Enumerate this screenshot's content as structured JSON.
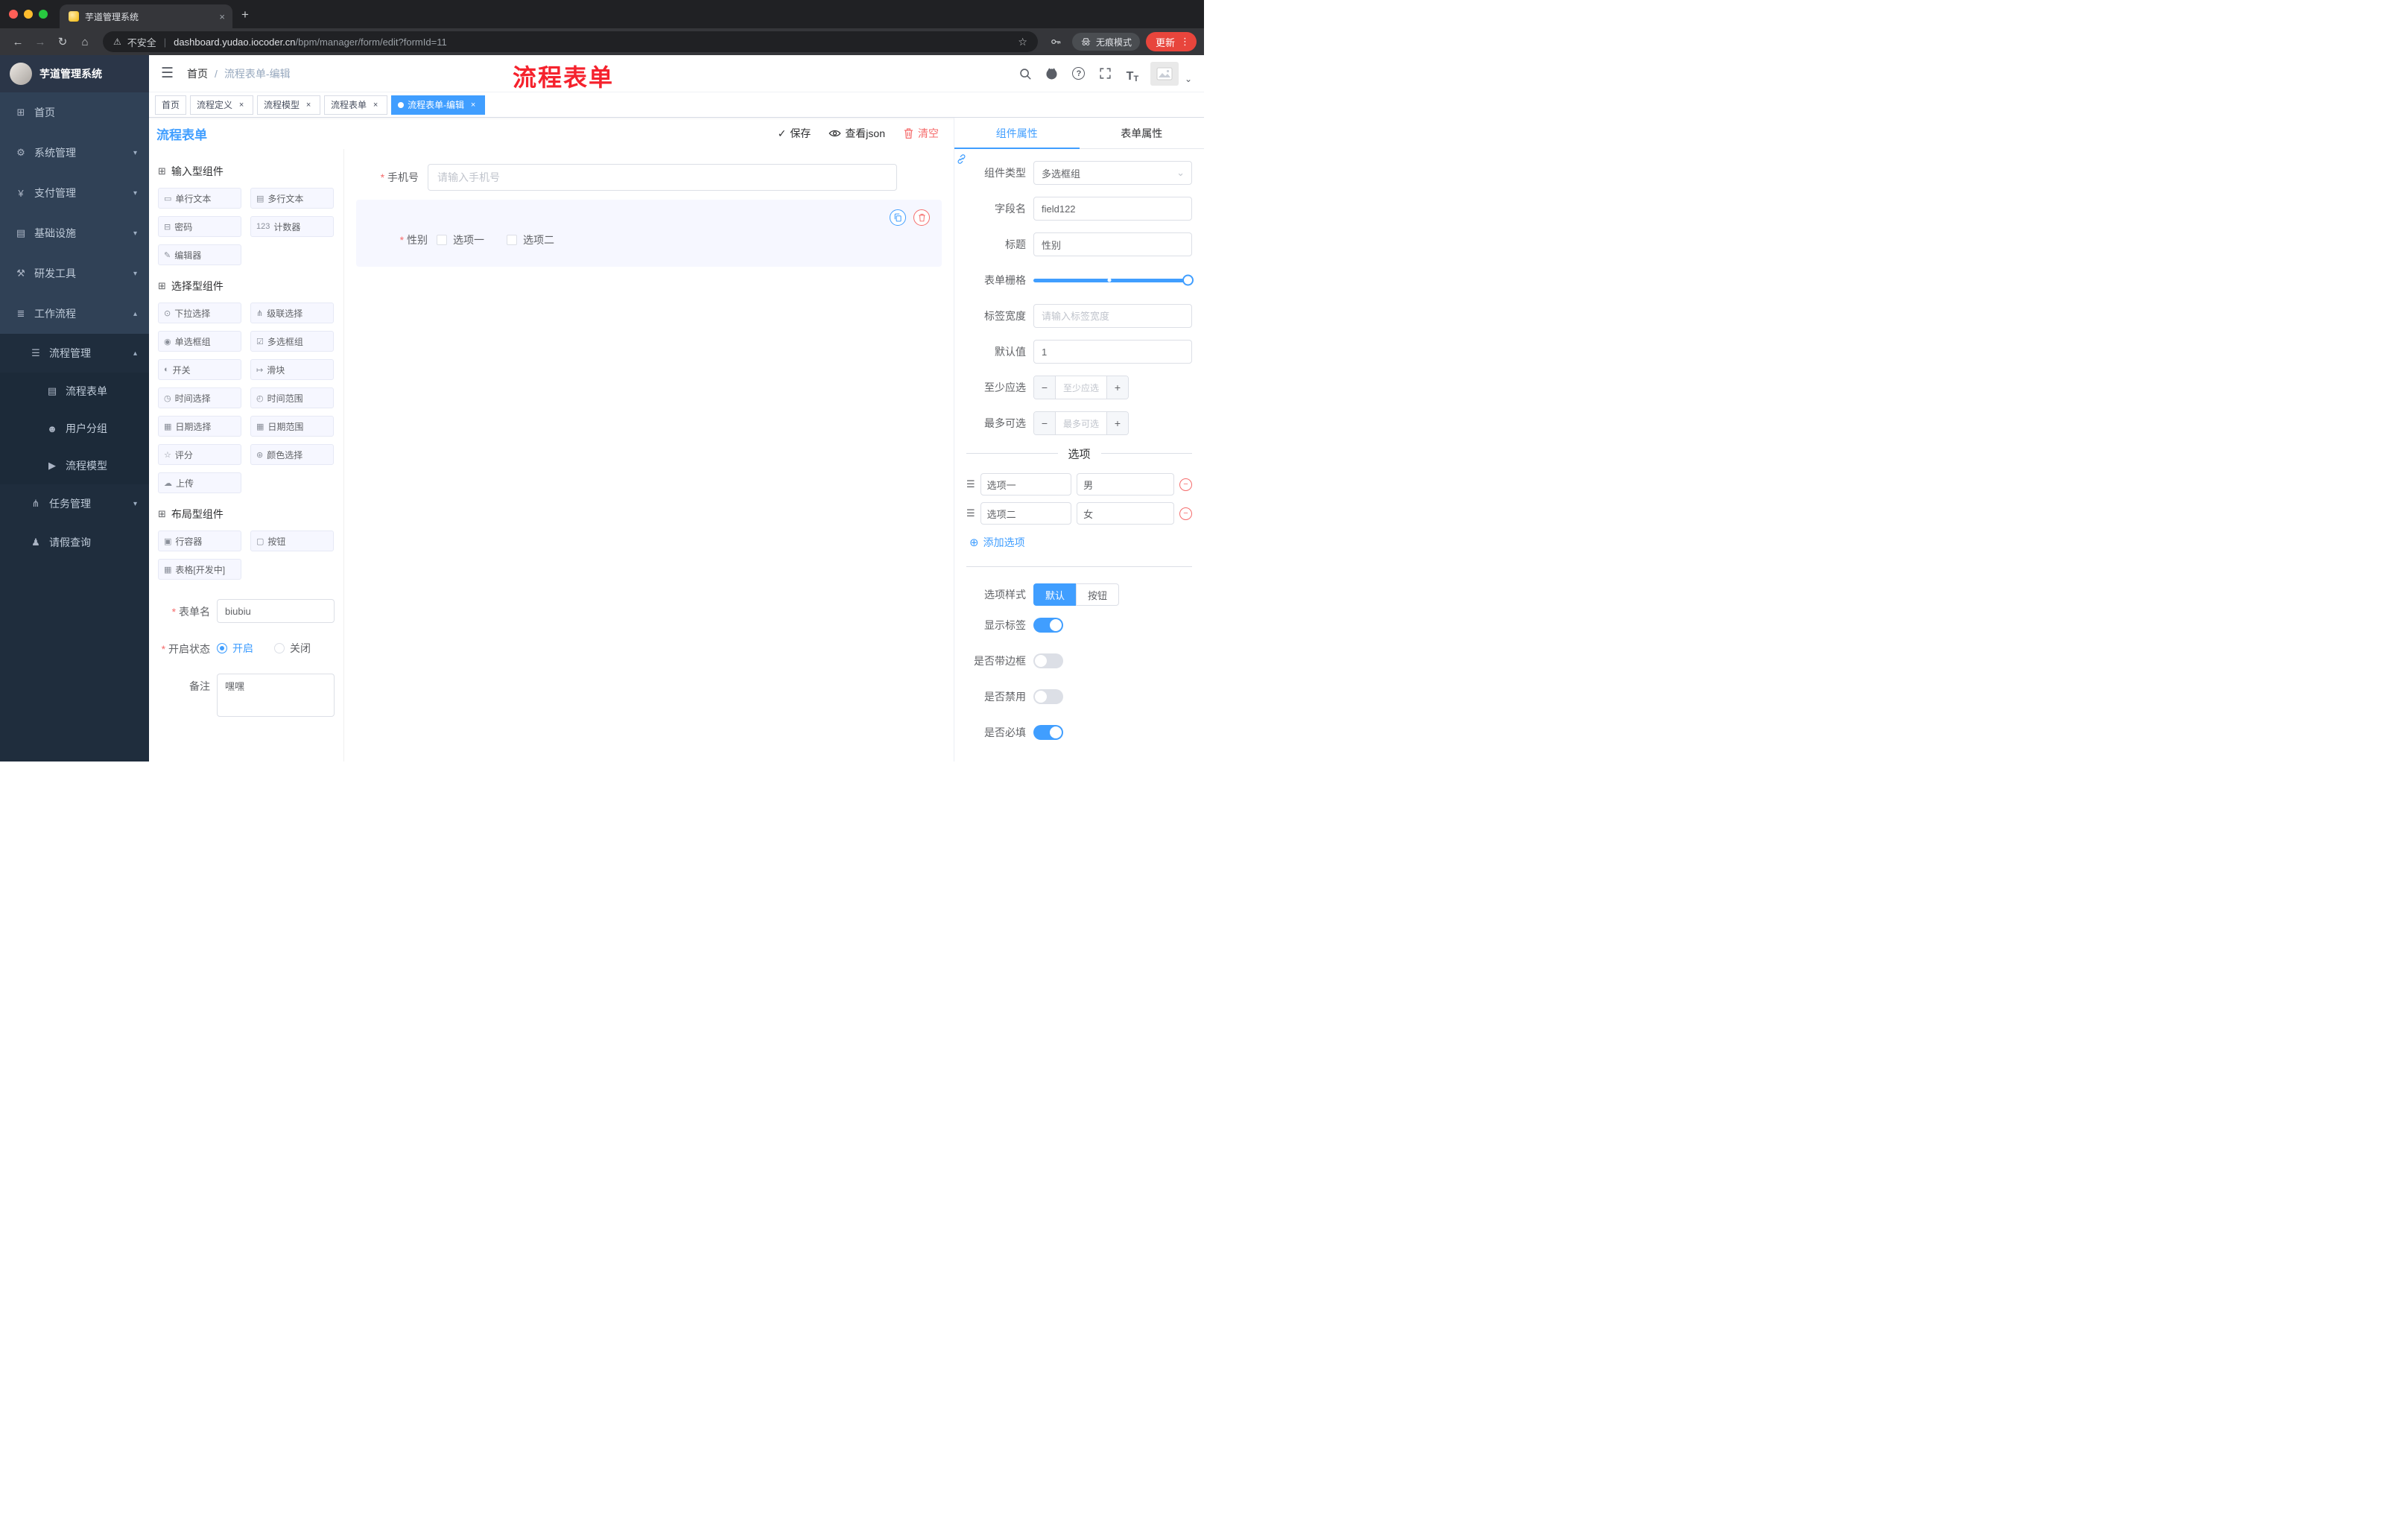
{
  "theme": {
    "primary": "#409eff",
    "danger": "#f56c6c",
    "sidebar_bg": "#304156",
    "submenu_bg": "#1f2d3d",
    "active_tag_bg": "#409eff",
    "overlay_red": "#f5222d",
    "chrome_bg": "#202124"
  },
  "glyphs": {
    "close": "×",
    "plus": "+",
    "back": "←",
    "forward": "→",
    "reload": "↻",
    "home": "⌂",
    "warning": "⚠",
    "pipe": "|",
    "star": "☆",
    "dots": "⋮",
    "caret": "⌄",
    "check": "✓",
    "chevron": "⌄",
    "minus": "−",
    "plus_sign": "+",
    "add_circle": "⊕",
    "drag": "☰",
    "hamburger": "☰",
    "question": "?",
    "font_size_big": "T",
    "font_size_small": "T"
  },
  "browser": {
    "tab_title": "芋道管理系统",
    "security_label": "不安全",
    "url_host": "dashboard.yudao.iocoder.cn",
    "url_path": "/bpm/manager/form/edit?formId=11",
    "incognito_label": "无痕模式",
    "update_label": "更新"
  },
  "navbar": {
    "breadcrumb_home": "首页",
    "breadcrumb_sep": "/",
    "breadcrumb_current": "流程表单-编辑",
    "overlay_title": "流程表单"
  },
  "tags": [
    {
      "label": "首页"
    },
    {
      "label": "流程定义"
    },
    {
      "label": "流程模型"
    },
    {
      "label": "流程表单"
    },
    {
      "label": "流程表单-编辑"
    }
  ],
  "sidebar": {
    "logo_title": "芋道管理系统",
    "items": [
      {
        "label": "首页",
        "glyph": "⊞"
      },
      {
        "label": "系统管理",
        "glyph": "⚙",
        "arrow": "▾"
      },
      {
        "label": "支付管理",
        "glyph": "¥",
        "arrow": "▾"
      },
      {
        "label": "基础设施",
        "glyph": "▤",
        "arrow": "▾"
      },
      {
        "label": "研发工具",
        "glyph": "⚒",
        "arrow": "▾"
      },
      {
        "label": "工作流程",
        "glyph": "≣",
        "arrow": "▴"
      },
      {
        "label": "流程管理",
        "glyph": "☰",
        "arrow": "▴"
      },
      {
        "label": "流程表单",
        "glyph": "▤"
      },
      {
        "label": "用户分组",
        "glyph": "☻"
      },
      {
        "label": "流程模型",
        "glyph": "▶"
      },
      {
        "label": "任务管理",
        "glyph": "⋔",
        "arrow": "▾"
      },
      {
        "label": "请假查询",
        "glyph": "♟"
      }
    ]
  },
  "designer": {
    "panel_title": "流程表单",
    "toolbar": {
      "save": "保存",
      "view_json": "查看json",
      "clear": "清空"
    },
    "palette": {
      "group1_title": "输入型组件",
      "group2_title": "选择型组件",
      "group3_title": "布局型组件",
      "group_icon": "⊞",
      "group1": [
        {
          "label": "单行文本",
          "glyph": "▭"
        },
        {
          "label": "多行文本",
          "glyph": "▤"
        },
        {
          "label": "密码",
          "glyph": "⊟"
        },
        {
          "label": "计数器",
          "glyph": "123"
        },
        {
          "label": "编辑器",
          "glyph": "✎"
        }
      ],
      "group2": [
        {
          "label": "下拉选择",
          "glyph": "⊙"
        },
        {
          "label": "级联选择",
          "glyph": "⋔"
        },
        {
          "label": "单选框组",
          "glyph": "◉"
        },
        {
          "label": "多选框组",
          "glyph": "☑"
        },
        {
          "label": "开关",
          "glyph": "◐"
        },
        {
          "label": "滑块",
          "glyph": "↦"
        },
        {
          "label": "时间选择",
          "glyph": "◷"
        },
        {
          "label": "时间范围",
          "glyph": "◴"
        },
        {
          "label": "日期选择",
          "glyph": "▦"
        },
        {
          "label": "日期范围",
          "glyph": "▦"
        },
        {
          "label": "评分",
          "glyph": "☆"
        },
        {
          "label": "颜色选择",
          "glyph": "⊛"
        },
        {
          "label": "上传",
          "glyph": "☁"
        }
      ],
      "group3": [
        {
          "label": "行容器",
          "glyph": "▣"
        },
        {
          "label": "按钮",
          "glyph": "▢"
        },
        {
          "label": "表格[开发中]",
          "glyph": "▦"
        }
      ]
    },
    "meta": {
      "name_label": "表单名",
      "name_value": "biubiu",
      "status_label": "开启状态",
      "status_on": "开启",
      "status_off": "关闭",
      "remark_label": "备注",
      "remark_value": "嘿嘿"
    },
    "canvas": {
      "phone_label": "手机号",
      "phone_placeholder": "请输入手机号",
      "gender_label": "性别",
      "gender_option1": "选项一",
      "gender_option2": "选项二"
    }
  },
  "inspector": {
    "tab_component": "组件属性",
    "tab_form": "表单属性",
    "rows": {
      "type_label": "组件类型",
      "type_value": "多选框组",
      "field_label": "字段名",
      "field_value": "field122",
      "title_label": "标题",
      "title_value": "性别",
      "grid_label": "表单栅格",
      "width_label": "标签宽度",
      "width_placeholder": "请输入标签宽度",
      "default_label": "默认值",
      "default_value": "1",
      "min_label": "至少应选",
      "min_placeholder": "至少应选",
      "max_label": "最多可选",
      "max_placeholder": "最多可选"
    },
    "options": {
      "divider_title": "选项",
      "rows": [
        {
          "label": "选项一",
          "value": "男"
        },
        {
          "label": "选项二",
          "value": "女"
        }
      ],
      "add_label": "添加选项"
    },
    "style": {
      "label": "选项样式",
      "option_default": "默认",
      "option_button": "按钮"
    },
    "switches": {
      "show_label": "显示标签",
      "border_label": "是否带边框",
      "disabled_label": "是否禁用",
      "required_label": "是否必填"
    }
  }
}
